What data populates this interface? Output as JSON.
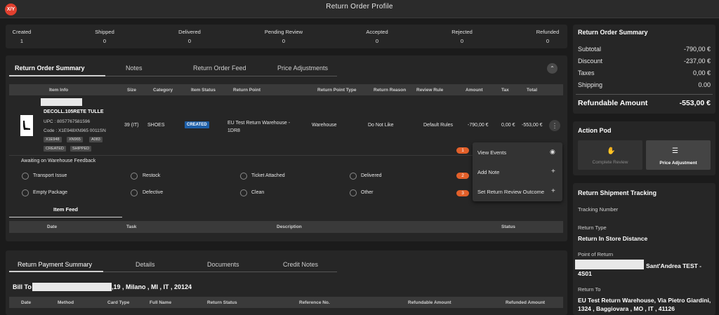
{
  "app": {
    "logo_text": "X/Y",
    "title": "Return Order Profile"
  },
  "stats": [
    {
      "label": "Created",
      "value": "1"
    },
    {
      "label": "Shipped",
      "value": "0"
    },
    {
      "label": "Delivered",
      "value": "0"
    },
    {
      "label": "Pending Review",
      "value": "0"
    },
    {
      "label": "Accepted",
      "value": "0"
    },
    {
      "label": "Rejected",
      "value": "0"
    },
    {
      "label": "Refunded",
      "value": "0"
    }
  ],
  "order_tabs": [
    "Return Order Summary",
    "Notes",
    "Return Order Feed",
    "Price Adjustments"
  ],
  "item_table": {
    "headers": [
      "Item Info",
      "Size",
      "Category",
      "Item Status",
      "Return Point",
      "Return Point Type",
      "Return Reason",
      "Review Rule",
      "Amount",
      "Tax",
      "Total"
    ],
    "row": {
      "name": "DECOLL.105RETE TULLE",
      "upc": "UPC : 8057767581596",
      "code": "Code : X1E948XN965 0011SN",
      "chips": [
        "X1E948",
        "XN965",
        "A083"
      ],
      "status_chips": [
        "CREATED",
        "SHIPPED"
      ],
      "size": "39 (IT)",
      "category": "SHOES",
      "item_status": "CREATED",
      "return_point": "EU Test Return Warehouse - 1DR8",
      "return_point_type": "Warehouse",
      "return_reason": "Do Not Like",
      "review_rule": "Default Rules",
      "amount": "-790,00 €",
      "tax": "0,00 €",
      "total": "-553,00 €"
    }
  },
  "warehouse": {
    "title": "Awaiting on Warehouse Feedback",
    "options": [
      "Transport Issue",
      "Restock",
      "Ticket Attached",
      "Delivered",
      "Empty Package",
      "Defective",
      "Clean",
      "Other"
    ]
  },
  "item_feed": {
    "title": "Item Feed",
    "headers": [
      "Date",
      "Task",
      "Description",
      "Status"
    ]
  },
  "dropdown": {
    "items": [
      {
        "label": "View Events",
        "badge": "1",
        "icon": "eye-icon"
      },
      {
        "label": "Add Note",
        "badge": "2",
        "icon": "plus-icon"
      },
      {
        "label": "Set Return Review Outcome",
        "badge": "3",
        "icon": "plus-icon"
      }
    ]
  },
  "payment_tabs": [
    "Return Payment Summary",
    "Details",
    "Documents",
    "Credit Notes"
  ],
  "bill_to": {
    "label": "Bill To",
    "address": ",19 , Milano , MI , IT , 20124"
  },
  "payment_table": {
    "headers": [
      "Date",
      "Method",
      "Card Type",
      "Full Name",
      "Return Status",
      "Reference No.",
      "Refundable Amount",
      "Refunded Amount"
    ]
  },
  "summary": {
    "title": "Return Order Summary",
    "rows": [
      {
        "label": "Subtotal",
        "value": "-790,00 €"
      },
      {
        "label": "Discount",
        "value": "-237,00 €"
      },
      {
        "label": "Taxes",
        "value": "0,00 €"
      },
      {
        "label": "Shipping",
        "value": "0.00"
      }
    ],
    "refundable_label": "Refundable Amount",
    "refundable_value": "-553,00 €"
  },
  "action_pod": {
    "title": "Action Pod",
    "complete_label": "Complete Review",
    "price_label": "Price Adjustment"
  },
  "tracking": {
    "title": "Return Shipment Tracking",
    "tracking_number_label": "Tracking Number",
    "return_type_label": "Return Type",
    "return_type_value": "Return In Store Distance",
    "point_label": "Point of Return",
    "point_value_a": "Sant'Andrea TEST -",
    "point_value_b": "4S01",
    "return_to_label": "Return To",
    "return_to_value": "EU Test Return Warehouse, Via Pietro Giardini, 1324 , Baggiovara , MO , IT , 41126"
  },
  "colors": {
    "accent_orange": "#e2602a",
    "logo_red": "#e2402f",
    "status_blue": "#1e5fa8"
  }
}
